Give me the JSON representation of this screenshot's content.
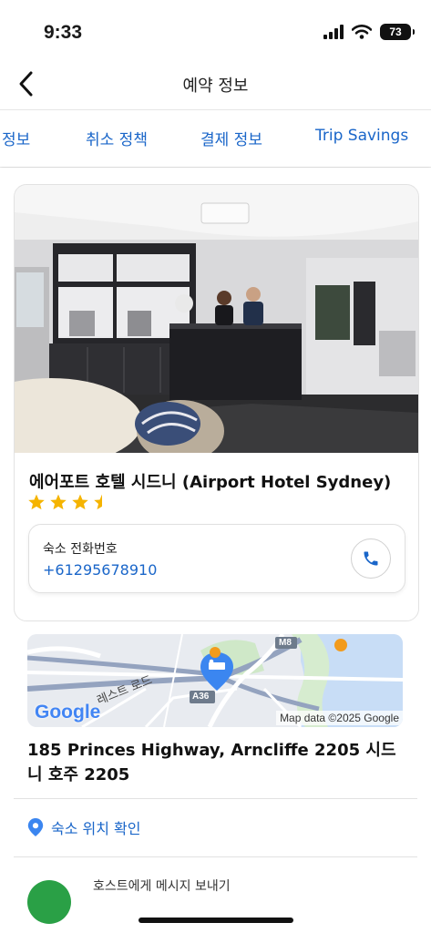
{
  "status": {
    "time": "9:33",
    "battery": "73"
  },
  "nav": {
    "title": "예약 정보"
  },
  "tabs": [
    "정보",
    "취소 정책",
    "결제 정보",
    "Trip Savings"
  ],
  "hotel": {
    "name": "에어포트 호텔 시드니 (Airport Hotel Sydney)",
    "rating": 3.5,
    "phone_label": "숙소 전화번호",
    "phone_number": "+61295678910"
  },
  "map": {
    "google_logo": "Google",
    "road_label": "레스트 로드",
    "route_a36": "A36",
    "route_m8": "M8",
    "attribution": "Map data ©2025 Google"
  },
  "address": "185 Princes Highway, Arncliffe 2205 시드니 호주 2205",
  "location_link": "숙소 위치 확인",
  "message_host": "호스트에게 메시지 보내기",
  "colors": {
    "accent": "#1a66c9",
    "star": "#f5b400",
    "pin": "#3b86f0",
    "avatar": "#2aa046"
  }
}
